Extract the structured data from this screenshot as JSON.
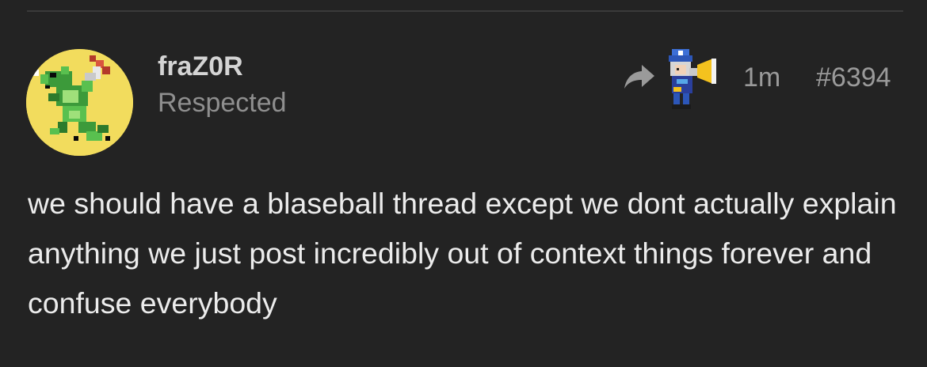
{
  "post": {
    "author": {
      "username": "fraZ0R",
      "title": "Respected",
      "avatar_icon": "pixel-dragon-avatar-icon",
      "avatar_bg": "#f2dc5d"
    },
    "meta": {
      "share_icon": "reply-arrow-icon",
      "badge_icon": "megaphone-sprite-icon",
      "time": "1m",
      "number": "#6394"
    },
    "body": "we should have a blaseball thread except we dont actually explain anything we just post incredibly out of context things forever and confuse everybody"
  },
  "colors": {
    "background": "#232323",
    "username": "#d4d4d4",
    "muted": "#8f8f8f",
    "body": "#ececec"
  }
}
